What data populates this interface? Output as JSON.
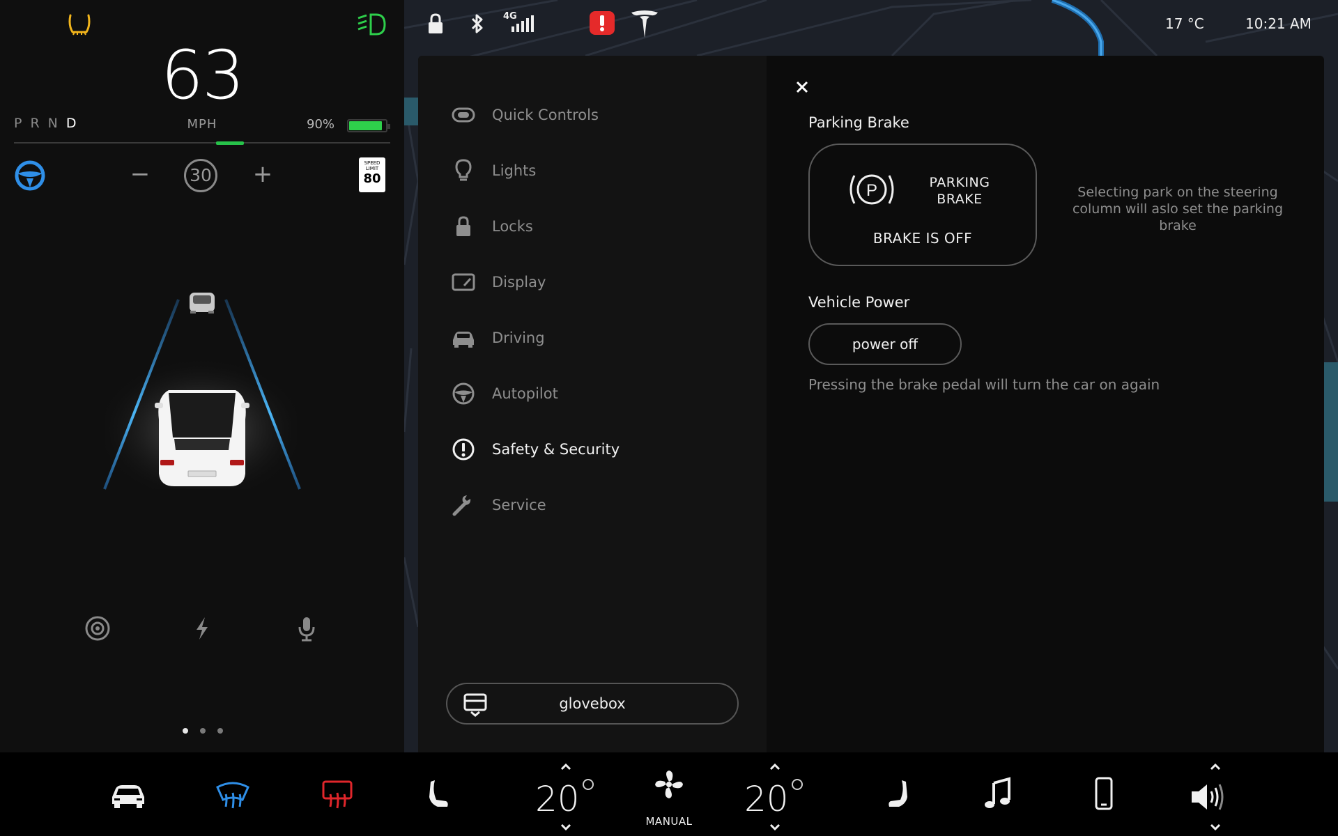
{
  "driver_panel": {
    "speed": "63",
    "speed_unit": "MPH",
    "gears": [
      "P",
      "R",
      "N",
      "D"
    ],
    "active_gear": "D",
    "battery_percent": "90%",
    "battery_level": 0.9,
    "cruise_set_speed": "30",
    "speed_limit_sign": {
      "caption": "SPEED LIMIT",
      "value": "80"
    },
    "page_dots": 3,
    "active_page_dot": 0,
    "icons": [
      "tire-pressure-warning-icon",
      "headlights-icon",
      "autopilot-wheel-icon",
      "camera-icon",
      "charging-icon",
      "microphone-icon"
    ]
  },
  "status_bar": {
    "temperature": "17 °C",
    "time": "10:21 AM",
    "network_label": "4G",
    "icons": [
      "lock-icon",
      "bluetooth-icon",
      "signal-icon",
      "alert-icon",
      "tesla-logo"
    ]
  },
  "settings": {
    "nav": [
      {
        "label": "Quick Controls",
        "icon": "toggle-icon"
      },
      {
        "label": "Lights",
        "icon": "bulb-icon"
      },
      {
        "label": "Locks",
        "icon": "lock-icon"
      },
      {
        "label": "Display",
        "icon": "display-icon"
      },
      {
        "label": "Driving",
        "icon": "car-icon"
      },
      {
        "label": "Autopilot",
        "icon": "steering-wheel-icon"
      },
      {
        "label": "Safety & Security",
        "icon": "exclamation-icon"
      },
      {
        "label": "Service",
        "icon": "wrench-icon"
      }
    ],
    "active_nav": "Safety & Security",
    "glovebox_label": "glovebox",
    "content": {
      "parking_brake_title": "Parking Brake",
      "parking_brake_button_label": "PARKING BRAKE",
      "parking_brake_status": "BRAKE IS OFF",
      "parking_brake_note": "Selecting park on the steering column will aslo set the parking brake",
      "vehicle_power_title": "Vehicle Power",
      "power_off_label": "power off",
      "power_note": "Pressing the brake pedal will turn the car on again"
    }
  },
  "bottom_bar": {
    "driver_temp": "20",
    "passenger_temp": "20",
    "fan_mode": "MANUAL",
    "icons": [
      "car-icon",
      "front-defrost-icon",
      "rear-defrost-icon",
      "driver-seat-heater-icon",
      "fan-icon",
      "passenger-seat-heater-icon",
      "music-icon",
      "phone-icon",
      "volume-icon"
    ]
  },
  "colors": {
    "accent_blue": "#2f8fe8",
    "battery_green": "#2ecf4b",
    "alert_red": "#e52a2a",
    "tpms_yellow": "#f2b51c",
    "rear_defrost_red": "#e0262b"
  }
}
